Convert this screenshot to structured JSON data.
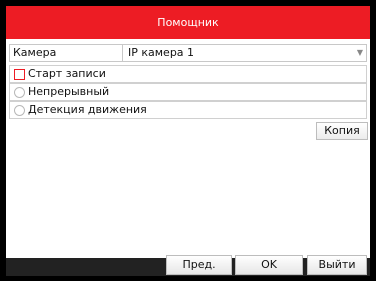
{
  "window": {
    "title": "Помощник",
    "accent_color": "#ed1c24"
  },
  "camera": {
    "label": "Камера",
    "selected": "IP камера 1",
    "dropdown_icon": "chevron-down-icon"
  },
  "options": [
    {
      "label": "Старт записи",
      "type": "checkbox",
      "checked": false
    },
    {
      "label": "Непрерывный",
      "type": "radio",
      "checked": false
    },
    {
      "label": "Детекция движения",
      "type": "radio",
      "checked": false
    }
  ],
  "actions": {
    "copy": "Копия"
  },
  "footer": {
    "prev": "Пред.",
    "ok": "OK",
    "exit": "Выйти"
  }
}
